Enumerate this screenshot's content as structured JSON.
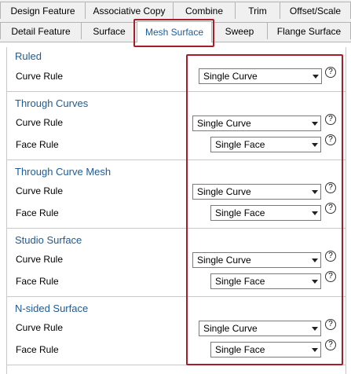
{
  "tabs_row1": [
    "Design Feature",
    "Associative Copy",
    "Combine",
    "Trim",
    "Offset/Scale"
  ],
  "tabs_row2": [
    "Detail Feature",
    "Surface",
    "Mesh Surface",
    "Sweep",
    "Flange Surface"
  ],
  "active_tab": "Mesh Surface",
  "help_glyph": "?",
  "groups": [
    {
      "title": "Ruled",
      "curve_rule_label": "Curve Rule",
      "curve_rule_value": "Single Curve"
    },
    {
      "title": "Through Curves",
      "curve_rule_label": "Curve Rule",
      "curve_rule_value": "Single Curve",
      "face_rule_label": "Face Rule",
      "face_rule_value": "Single Face"
    },
    {
      "title": "Through Curve Mesh",
      "curve_rule_label": "Curve Rule",
      "curve_rule_value": "Single Curve",
      "face_rule_label": "Face Rule",
      "face_rule_value": "Single Face"
    },
    {
      "title": "Studio Surface",
      "curve_rule_label": "Curve Rule",
      "curve_rule_value": "Single Curve",
      "face_rule_label": "Face Rule",
      "face_rule_value": "Single Face"
    },
    {
      "title": "N-sided Surface",
      "curve_rule_label": "Curve Rule",
      "curve_rule_value": "Single Curve",
      "face_rule_label": "Face Rule",
      "face_rule_value": "Single Face"
    }
  ]
}
